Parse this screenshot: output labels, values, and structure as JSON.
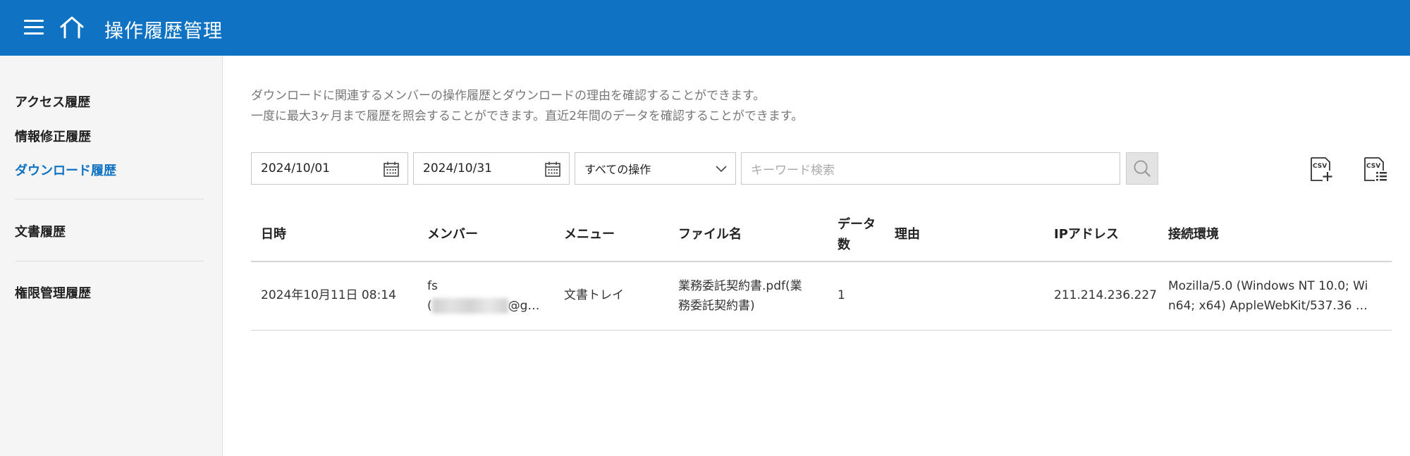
{
  "header": {
    "title": "操作履歴管理"
  },
  "sidebar": {
    "items": [
      {
        "label": "アクセス履歴"
      },
      {
        "label": "情報修正履歴"
      },
      {
        "label": "ダウンロード履歴"
      },
      {
        "label": "文書履歴"
      },
      {
        "label": "権限管理履歴"
      }
    ],
    "active_index": 2
  },
  "description": {
    "line1": "ダウンロードに関連するメンバーの操作履歴とダウンロードの理由を確認することができます。",
    "line2": "一度に最大3ヶ月まで履歴を照会することができます。直近2年間のデータを確認することができます。"
  },
  "filters": {
    "start_date": "2024/10/01",
    "end_date": "2024/10/31",
    "operation_select": "すべての操作",
    "keyword_placeholder": "キーワード検索"
  },
  "csv_buttons": [
    "CSV",
    "CSV"
  ],
  "table": {
    "headers": [
      "日時",
      "メンバー",
      "メニュー",
      "ファイル名",
      "データ",
      "数",
      "理由",
      "IPアドレス",
      "接続環境"
    ],
    "rows": [
      {
        "datetime": "2024年10月11日 08:14",
        "member_line1": "fs",
        "member_open": "(",
        "member_domain": "@g…",
        "menu": "文書トレイ",
        "file_line1": "業務委託契約書.pdf(業",
        "file_line2": "務委託契約書)",
        "data_count": "1",
        "reason": "",
        "ip": "211.214.236.227",
        "env_line1": "Mozilla/5.0 (Windows NT 10.0; Wi",
        "env_line2": "n64; x64) AppleWebKit/537.36 …"
      }
    ]
  },
  "colors": {
    "header_bg": "#0f72c3",
    "accent": "#0f72c3",
    "sidebar_bg": "#f5f5f5"
  }
}
